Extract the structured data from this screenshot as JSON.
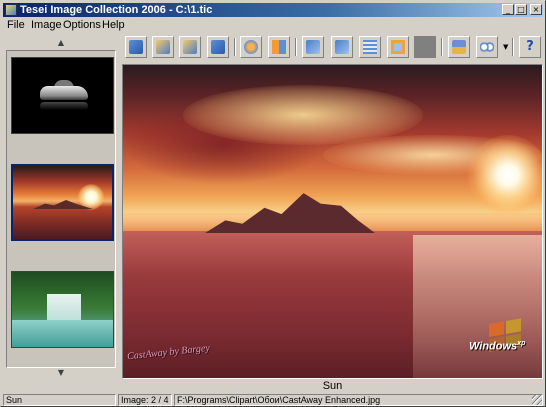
{
  "window": {
    "title": "Tesei Image Collection 2006 - C:\\1.tic",
    "minimize_glyph": "_",
    "maximize_glyph": "□",
    "close_glyph": "×"
  },
  "menu": {
    "items": [
      {
        "label": "File"
      },
      {
        "label": "Image"
      },
      {
        "label": "Options"
      },
      {
        "label": "Help"
      }
    ]
  },
  "thumbnails": {
    "scroll_up_glyph": "▲",
    "scroll_down_glyph": "▼",
    "items": [
      {
        "subject": "car",
        "selected": false
      },
      {
        "subject": "sunset",
        "selected": true
      },
      {
        "subject": "waterfall",
        "selected": false
      }
    ]
  },
  "toolbar": {
    "buttons": [
      {
        "icon": "new-collection-icon"
      },
      {
        "icon": "open-collection-icon"
      },
      {
        "icon": "save-collection-icon"
      },
      {
        "icon": "import-icon"
      },
      {
        "icon": "slideshow-icon"
      },
      {
        "icon": "thumbnails-view-icon"
      },
      {
        "icon": "rotate-left-icon"
      },
      {
        "icon": "rotate-right-icon"
      },
      {
        "icon": "properties-icon"
      },
      {
        "icon": "fit-frame-icon"
      },
      {
        "icon": "background-color-icon"
      },
      {
        "icon": "print-icon"
      },
      {
        "icon": "view-mode-icon"
      },
      {
        "icon": "help-icon"
      }
    ],
    "help_glyph": "?",
    "dropdown_glyph": "▼"
  },
  "viewer": {
    "image_subject": "sunset-over-sea",
    "signature_text": "CastAway by Bargey",
    "logo_text": "Windows",
    "logo_superscript": "xp",
    "caption": "Sun"
  },
  "status": {
    "name": "Sun",
    "position": "Image: 2 / 4",
    "path": "F:\\Programs\\Clipart\\Обои\\CastAway Enhanced.jpg"
  }
}
